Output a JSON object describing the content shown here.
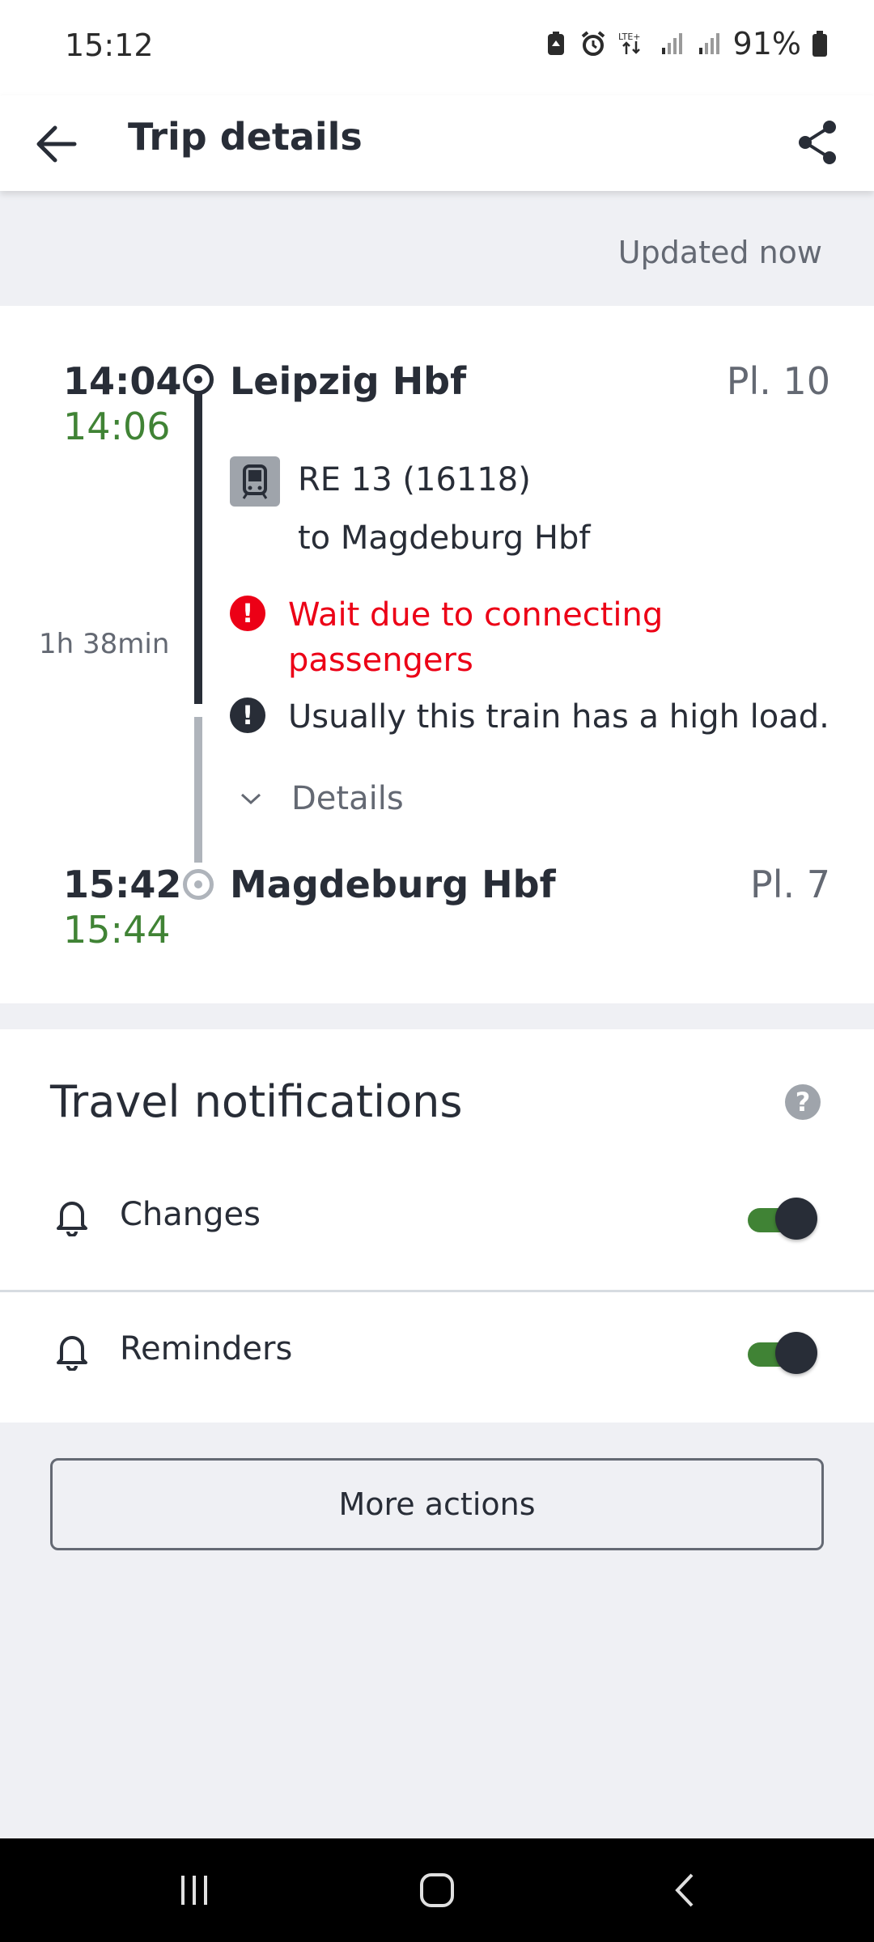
{
  "status_bar": {
    "time": "15:12",
    "network": "LTE+",
    "battery": "91%"
  },
  "app_bar": {
    "title": "Trip details"
  },
  "updated": "Updated now",
  "trip": {
    "departure": {
      "planned": "14:04",
      "actual": "14:06",
      "station": "Leipzig Hbf",
      "platform": "Pl. 10"
    },
    "train": {
      "name": "RE 13 (16118)",
      "destination": "to Magdeburg Hbf"
    },
    "duration": "1h 38min",
    "messages": {
      "warning": "Wait due to connecting passengers",
      "info": "Usually this train has a high load."
    },
    "details_label": "Details",
    "arrival": {
      "planned": "15:42",
      "actual": "15:44",
      "station": "Magdeburg Hbf",
      "platform": "Pl. 7"
    }
  },
  "notifications": {
    "title": "Travel notifications",
    "help_icon": "?",
    "rows": [
      {
        "label": "Changes",
        "enabled": true
      },
      {
        "label": "Reminders",
        "enabled": true
      }
    ]
  },
  "more_actions_label": "More actions",
  "colors": {
    "text": "#282d37",
    "realtime_green": "#408335",
    "warning_red": "#ec0016",
    "muted": "#646973",
    "background": "#eff0f4"
  }
}
